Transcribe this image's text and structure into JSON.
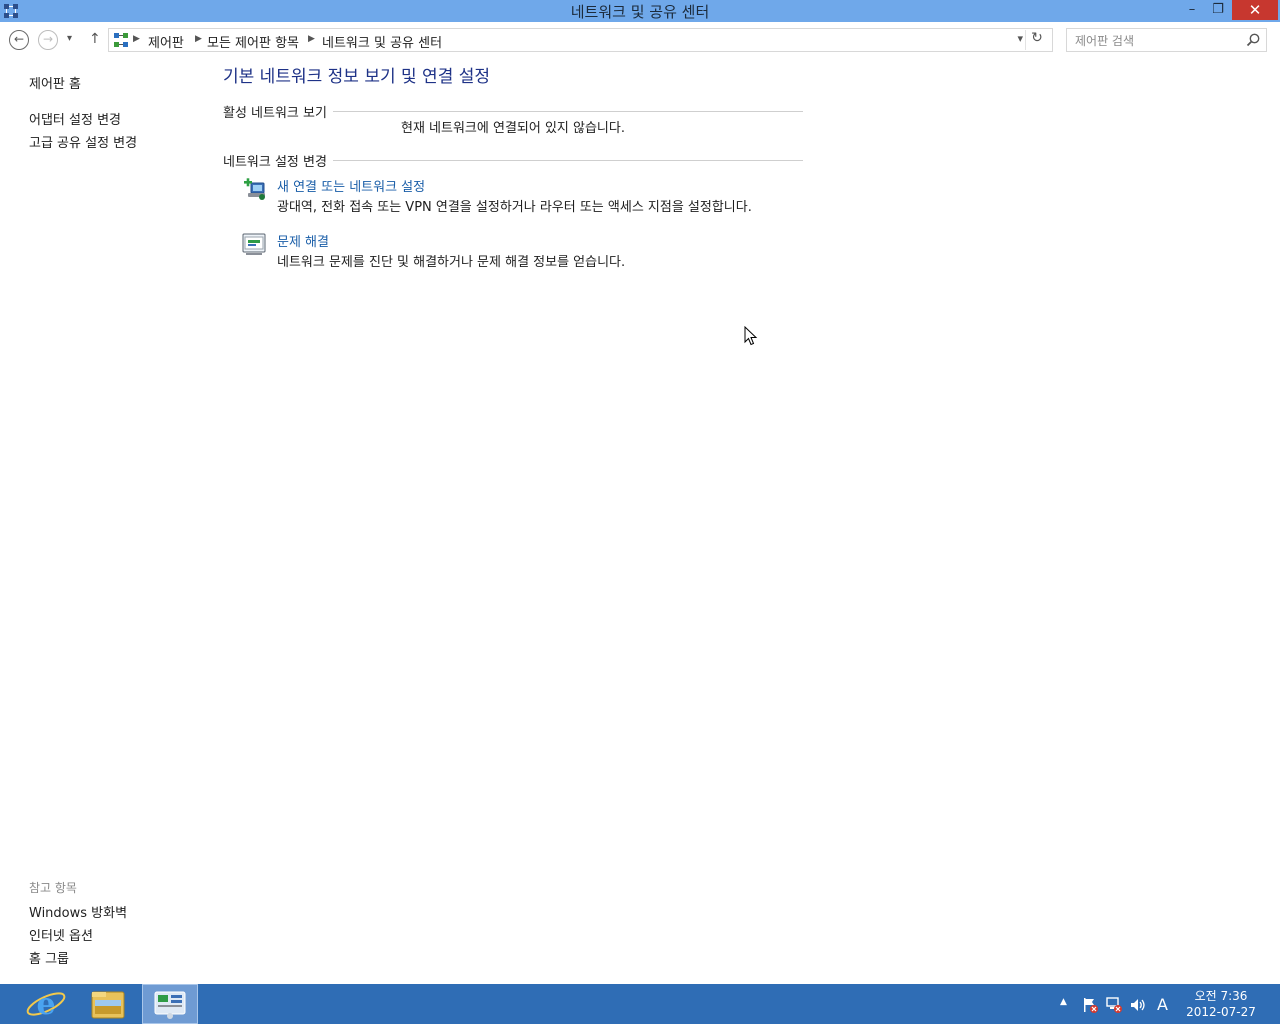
{
  "window": {
    "title": "네트워크 및 공유 센터",
    "controls": {
      "minimize": "–",
      "maximize": "❐",
      "close": "✕"
    }
  },
  "nav": {
    "back_glyph": "←",
    "forward_glyph": "→",
    "recent_glyph": "▾",
    "up_glyph": "↑"
  },
  "address": {
    "crumbs": [
      "제어판",
      "모든 제어판 항목",
      "네트워크 및 공유 센터"
    ],
    "separator": "▶",
    "dropdown_glyph": "▾",
    "refresh_glyph": "↻"
  },
  "search": {
    "placeholder": "제어판 검색",
    "value": ""
  },
  "sidebar": {
    "home": "제어판 홈",
    "links": [
      "어댑터 설정 변경",
      "고급 공유 설정 변경"
    ],
    "see_also_title": "참고 항목",
    "see_also": [
      "Windows 방화벽",
      "인터넷 옵션",
      "홈 그룹"
    ]
  },
  "main": {
    "title": "기본 네트워크 정보 보기 및 연결 설정",
    "active_section": "활성 네트워크 보기",
    "status": "현재 네트워크에 연결되어 있지 않습니다.",
    "change_section": "네트워크 설정 변경",
    "tasks": [
      {
        "icon": "new-connection-icon",
        "link": "새 연결 또는 네트워크 설정",
        "desc": "광대역, 전화 접속 또는 VPN 연결을 설정하거나 라우터 또는 액세스 지점을 설정합니다."
      },
      {
        "icon": "troubleshoot-icon",
        "link": "문제 해결",
        "desc": "네트워크 문제를 진단 및 해결하거나 문제 해결 정보를 얻습니다."
      }
    ]
  },
  "taskbar": {
    "pinned": [
      "internet-explorer-icon",
      "file-explorer-icon",
      "control-panel-icon"
    ],
    "tray": {
      "show_hidden": "▲",
      "ime": "A"
    },
    "clock": {
      "time": "오전 7:36",
      "date": "2012-07-27"
    }
  },
  "colors": {
    "titlebar": "#6fa8ea",
    "taskbar": "#2f6db5",
    "link": "#1a5ea8",
    "heading": "#1e3287"
  }
}
